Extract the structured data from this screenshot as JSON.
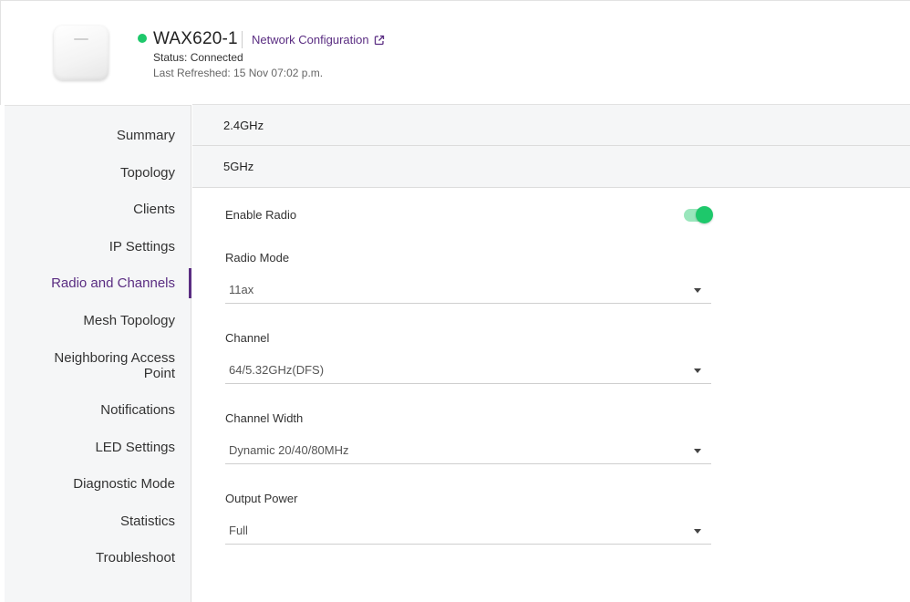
{
  "colors": {
    "accent": "#5a2d82",
    "status_connected": "#1ec86b",
    "toggle_on": "#1ec86b"
  },
  "header": {
    "device_name": "WAX620-1",
    "network_config_label": "Network Configuration",
    "network_config_icon": "external-link-icon",
    "status_text": "Status: Connected",
    "last_refreshed": "Last Refreshed: 15 Nov 07:02 p.m."
  },
  "sidebar": {
    "items": [
      {
        "label": "Summary"
      },
      {
        "label": "Topology"
      },
      {
        "label": "Clients"
      },
      {
        "label": "IP Settings"
      },
      {
        "label": "Radio and Channels",
        "active": true
      },
      {
        "label": "Mesh Topology"
      },
      {
        "label": "Neighboring Access Point"
      },
      {
        "label": "Notifications"
      },
      {
        "label": "LED Settings"
      },
      {
        "label": "Diagnostic Mode"
      },
      {
        "label": "Statistics"
      },
      {
        "label": "Troubleshoot"
      }
    ]
  },
  "bands": [
    {
      "label": "2.4GHz"
    },
    {
      "label": "5GHz"
    }
  ],
  "form": {
    "enable_radio_label": "Enable Radio",
    "enable_radio_on": true,
    "radio_mode": {
      "label": "Radio Mode",
      "value": "11ax"
    },
    "channel": {
      "label": "Channel",
      "value": "64/5.32GHz(DFS)"
    },
    "channel_width": {
      "label": "Channel Width",
      "value": "Dynamic 20/40/80MHz"
    },
    "output_power": {
      "label": "Output Power",
      "value": "Full"
    }
  }
}
